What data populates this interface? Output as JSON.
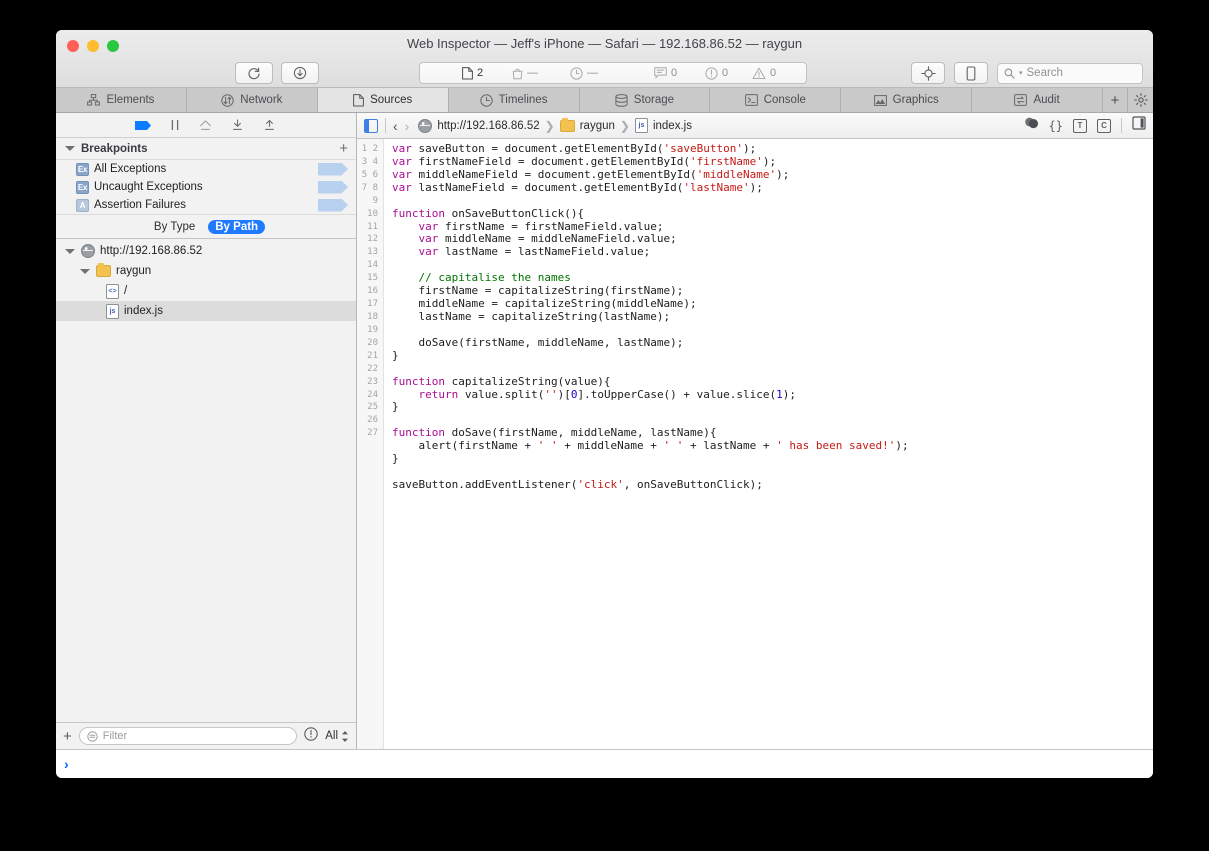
{
  "window": {
    "title": "Web Inspector — Jeff's iPhone — Safari — 192.168.86.52 — raygun"
  },
  "toolbar": {
    "reload_label": "reload-icon",
    "download_label": "download-icon",
    "counters": [
      {
        "name": "resources",
        "icon": "document-icon",
        "value": "2",
        "active": true
      },
      {
        "name": "downloads",
        "icon": "bag-icon",
        "value": "—",
        "active": false
      },
      {
        "name": "time",
        "icon": "clock-icon",
        "value": "—",
        "active": false
      },
      {
        "name": "logs",
        "icon": "message-icon",
        "value": "0",
        "active": false
      },
      {
        "name": "errors",
        "icon": "error-icon",
        "value": "0",
        "active": false
      },
      {
        "name": "warnings",
        "icon": "warning-icon",
        "value": "0",
        "active": false
      }
    ],
    "inspect_label": "node-inspect-icon",
    "device_label": "device-icon",
    "search_placeholder": "Search"
  },
  "tabs": [
    {
      "label": "Elements",
      "icon": "elements-icon",
      "active": false
    },
    {
      "label": "Network",
      "icon": "network-icon",
      "active": false
    },
    {
      "label": "Sources",
      "icon": "sources-icon",
      "active": true
    },
    {
      "label": "Timelines",
      "icon": "timelines-icon",
      "active": false
    },
    {
      "label": "Storage",
      "icon": "storage-icon",
      "active": false
    },
    {
      "label": "Console",
      "icon": "console-icon",
      "active": false
    },
    {
      "label": "Graphics",
      "icon": "graphics-icon",
      "active": false
    },
    {
      "label": "Audit",
      "icon": "audit-icon",
      "active": false
    }
  ],
  "tab_extras": {
    "add": "+",
    "settings": "gear-icon"
  },
  "sidebar": {
    "debugger_controls": [
      {
        "name": "activate-breakpoints",
        "icon": "breakpoint-arrow-icon",
        "active": true
      },
      {
        "name": "pause-resume",
        "icon": "pause-icon",
        "active": false
      },
      {
        "name": "step-over",
        "icon": "step-over-icon",
        "active": false
      },
      {
        "name": "step-into",
        "icon": "step-into-icon",
        "active": false
      },
      {
        "name": "step-out",
        "icon": "step-out-icon",
        "active": false
      }
    ],
    "breakpoints_section": {
      "title": "Breakpoints",
      "add_label": "+",
      "items": [
        {
          "badge": "Ex",
          "label": "All Exceptions",
          "badge_style": "dark"
        },
        {
          "badge": "Ex",
          "label": "Uncaught Exceptions",
          "badge_style": "dark"
        },
        {
          "badge": "A",
          "label": "Assertion Failures",
          "badge_style": "light"
        }
      ]
    },
    "grouping": {
      "by_type": "By Type",
      "by_path": "By Path",
      "selected": "By Path"
    },
    "tree": [
      {
        "label": "http://192.168.86.52",
        "icon": "globe-icon",
        "depth": 0,
        "expanded": true,
        "selected": false
      },
      {
        "label": "raygun",
        "icon": "folder-icon",
        "depth": 1,
        "expanded": true,
        "selected": false
      },
      {
        "label": "/",
        "icon": "html-file-icon",
        "depth": 2,
        "expanded": false,
        "selected": false
      },
      {
        "label": "index.js",
        "icon": "js-file-icon",
        "depth": 2,
        "expanded": false,
        "selected": true
      }
    ],
    "footer": {
      "add_label": "+",
      "filter_placeholder": "Filter",
      "filter_value": "",
      "issues_icon": "exclamation-circle-icon",
      "scope_label": "All"
    }
  },
  "navbar": {
    "panel_toggle": "sidebar-toggle-icon",
    "back": "‹",
    "forward": "›",
    "breadcrumbs": [
      {
        "label": "http://192.168.86.52",
        "icon": "globe-icon"
      },
      {
        "label": "raygun",
        "icon": "folder-icon"
      },
      {
        "label": "index.js",
        "icon": "js-file-icon"
      }
    ],
    "right_icons": [
      {
        "name": "resources-icon",
        "glyph": ""
      },
      {
        "name": "pretty-print-icon",
        "glyph": "{}"
      },
      {
        "name": "show-type-icon",
        "glyph": "T"
      },
      {
        "name": "continue-icon",
        "glyph": "C"
      },
      {
        "name": "details-sidebar-toggle-icon",
        "glyph": ""
      }
    ]
  },
  "editor": {
    "filename": "index.js",
    "line_count": 27,
    "lines": [
      [
        [
          "kw",
          "var"
        ],
        [
          "txt",
          " saveButton = document.getElementById("
        ],
        [
          "str",
          "'saveButton'"
        ],
        [
          "txt",
          ");"
        ]
      ],
      [
        [
          "kw",
          "var"
        ],
        [
          "txt",
          " firstNameField = document.getElementById("
        ],
        [
          "str",
          "'firstName'"
        ],
        [
          "txt",
          ");"
        ]
      ],
      [
        [
          "kw",
          "var"
        ],
        [
          "txt",
          " middleNameField = document.getElementById("
        ],
        [
          "str",
          "'middleName'"
        ],
        [
          "txt",
          ");"
        ]
      ],
      [
        [
          "kw",
          "var"
        ],
        [
          "txt",
          " lastNameField = document.getElementById("
        ],
        [
          "str",
          "'lastName'"
        ],
        [
          "txt",
          ");"
        ]
      ],
      [],
      [
        [
          "kw",
          "function"
        ],
        [
          "txt",
          " onSaveButtonClick(){"
        ]
      ],
      [
        [
          "txt",
          "    "
        ],
        [
          "kw",
          "var"
        ],
        [
          "txt",
          " firstName = firstNameField.value;"
        ]
      ],
      [
        [
          "txt",
          "    "
        ],
        [
          "kw",
          "var"
        ],
        [
          "txt",
          " middleName = middleNameField.value;"
        ]
      ],
      [
        [
          "txt",
          "    "
        ],
        [
          "kw",
          "var"
        ],
        [
          "txt",
          " lastName = lastNameField.value;"
        ]
      ],
      [],
      [
        [
          "txt",
          "    "
        ],
        [
          "com",
          "// capitalise the names"
        ]
      ],
      [
        [
          "txt",
          "    firstName = capitalizeString(firstName);"
        ]
      ],
      [
        [
          "txt",
          "    middleName = capitalizeString(middleName);"
        ]
      ],
      [
        [
          "txt",
          "    lastName = capitalizeString(lastName);"
        ]
      ],
      [],
      [
        [
          "txt",
          "    doSave(firstName, middleName, lastName);"
        ]
      ],
      [
        [
          "txt",
          "}"
        ]
      ],
      [],
      [
        [
          "kw",
          "function"
        ],
        [
          "txt",
          " capitalizeString(value){"
        ]
      ],
      [
        [
          "txt",
          "    "
        ],
        [
          "kw",
          "return"
        ],
        [
          "txt",
          " value.split("
        ],
        [
          "str",
          "''"
        ],
        [
          "txt",
          ")["
        ],
        [
          "num",
          "0"
        ],
        [
          "txt",
          "].toUpperCase() + value.slice("
        ],
        [
          "num",
          "1"
        ],
        [
          "txt",
          ");"
        ]
      ],
      [
        [
          "txt",
          "}"
        ]
      ],
      [],
      [
        [
          "kw",
          "function"
        ],
        [
          "txt",
          " doSave(firstName, middleName, lastName){"
        ]
      ],
      [
        [
          "txt",
          "    alert(firstName + "
        ],
        [
          "str",
          "' '"
        ],
        [
          "txt",
          " + middleName + "
        ],
        [
          "str",
          "' '"
        ],
        [
          "txt",
          " + lastName + "
        ],
        [
          "str",
          "' has been saved!'"
        ],
        [
          "txt",
          ");"
        ]
      ],
      [
        [
          "txt",
          "}"
        ]
      ],
      [],
      [
        [
          "txt",
          "saveButton.addEventListener("
        ],
        [
          "str",
          "'click'"
        ],
        [
          "txt",
          ", onSaveButtonClick);"
        ]
      ]
    ]
  },
  "console": {
    "prompt": "›"
  },
  "colors": {
    "accent_blue": "#207aff",
    "prompt_blue": "#0a6cff",
    "keyword": "#aa0d91",
    "string": "#c41a16",
    "comment": "#007400",
    "number": "#1c00cf",
    "breakpoint_marker": "#b8d1ee"
  }
}
